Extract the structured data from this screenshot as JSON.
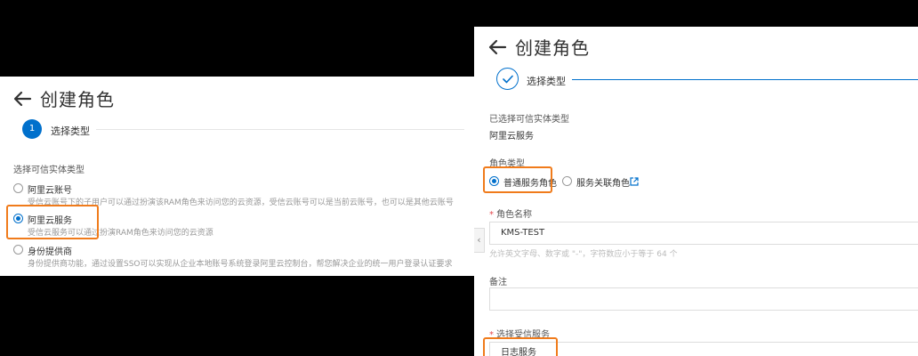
{
  "left": {
    "title": "创建角色",
    "step": {
      "number": "1",
      "label": "选择类型"
    },
    "section_label": "选择可信实体类型",
    "options": [
      {
        "title": "阿里云账号",
        "desc": "受信云账号下的子用户可以通过扮演该RAM角色来访问您的云资源，受信云账号可以是当前云账号，也可以是其他云账号",
        "checked": false
      },
      {
        "title": "阿里云服务",
        "desc": "受信云服务可以通过扮演RAM角色来访问您的云资源",
        "checked": true
      },
      {
        "title": "身份提供商",
        "desc": "身份提供商功能，通过设置SSO可以实现从企业本地账号系统登录阿里云控制台，帮您解决企业的统一用户登录认证要求",
        "checked": false
      }
    ]
  },
  "right": {
    "title": "创建角色",
    "step": {
      "label": "选择类型"
    },
    "selected_entity_label": "已选择可信实体类型",
    "selected_entity_value": "阿里云服务",
    "role_type_label": "角色类型",
    "role_types": [
      {
        "label": "普通服务角色",
        "checked": true
      },
      {
        "label": "服务关联角色",
        "checked": false
      }
    ],
    "role_name_label": "角色名称",
    "role_name_value": "KMS-TEST",
    "role_name_hint": "允许英文字母、数字或 \"-\"，字符数应小于等于 64 个",
    "note_label": "备注",
    "note_value": "",
    "service_label": "选择受信服务",
    "service_value": "日志服务"
  },
  "colors": {
    "accent": "#0070cc",
    "highlight": "#f07b1b",
    "required": "#e5484d"
  },
  "icons": {
    "back": "arrow-left-icon",
    "external": "external-link-icon",
    "collapse": "chevron-left-icon",
    "check": "check-icon"
  }
}
